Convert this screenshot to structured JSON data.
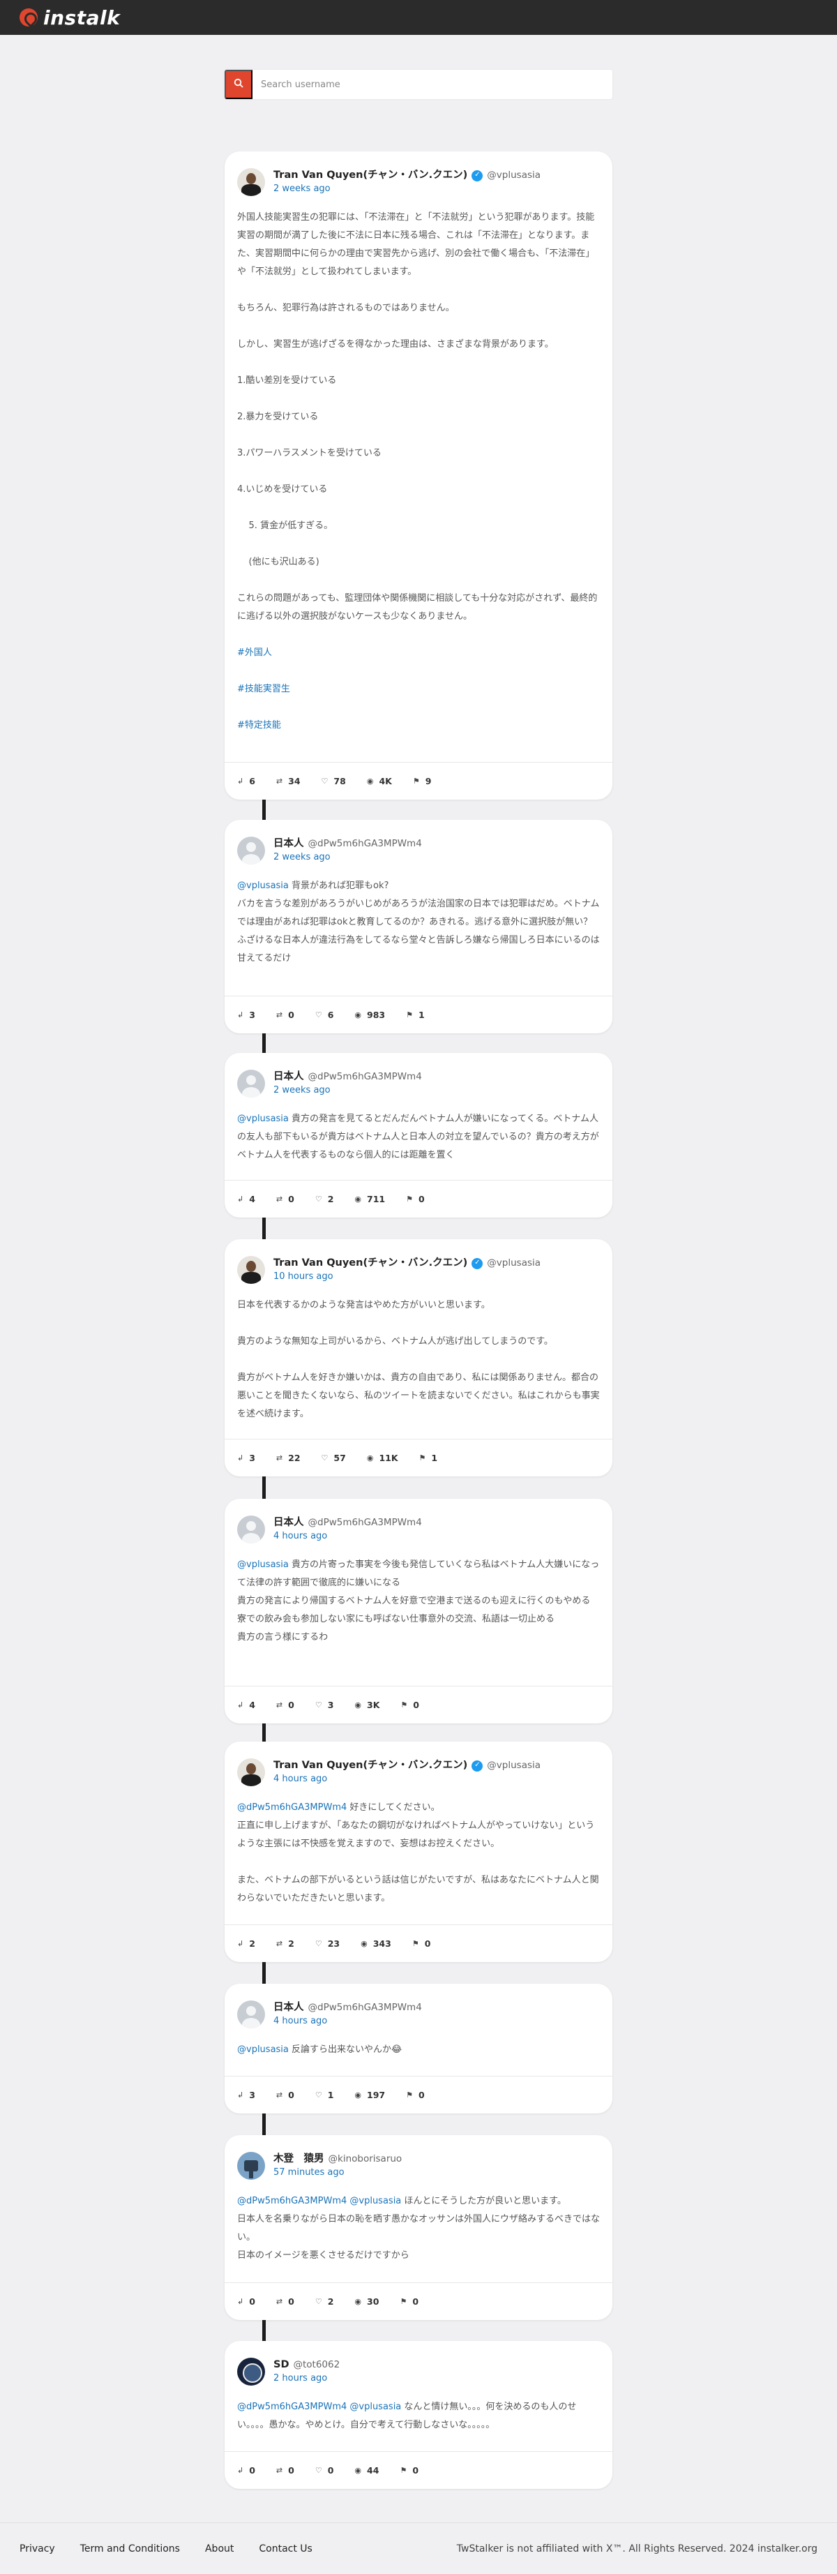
{
  "brand": {
    "logo_text": "instalk"
  },
  "search": {
    "placeholder": "Search username",
    "button_icon": "search-icon"
  },
  "posts": [
    {
      "name": "Tran Van Quyen(チャン・バン.クエン)",
      "verified": true,
      "handle": "@vplusasia",
      "time": "2 weeks ago",
      "lines": [
        "外国人技能実習生の犯罪には、「不法滞在」と「不法就労」という犯罪があります。技能実習の期間が満了した後に不法に日本に残る場合、これは「不法滞在」となります。また、実習期間中に何らかの理由で実習先から逃げ、別の会社で働く場合も、「不法滞在」や「不法就労」として扱われてしまいます。",
        "",
        "もちろん、犯罪行為は許されるものではありません。",
        "",
        "しかし、実習生が逃げざるを得なかった理由は、さまざまな背景があります。",
        "",
        "1.酷い差別を受けている",
        "",
        "2.暴力を受けている",
        "",
        "3.パワーハラスメントを受けている",
        "",
        "4.いじめを受けている",
        "",
        "    5. 賃金が低すぎる。",
        "",
        "    (他にも沢山ある)",
        "",
        "これらの問題があっても、監理団体や関係機関に相談しても十分な対応がされず、最終的に逃げる以外の選択肢がないケースも少なくありません。",
        "",
        "#外国人",
        "",
        "#技能実習生",
        "",
        "#特定技能"
      ],
      "stats": [
        "6",
        "34",
        "78",
        "4K",
        "9"
      ]
    },
    {
      "name": "日本人",
      "verified": false,
      "handle": "@dPw5m6hGA3MPWm4",
      "time": "2 weeks ago",
      "lines": [
        "@vplusasia 背景があれば犯罪もok?",
        "バカを言うな差別があろうがいじめがあろうが法治国家の日本では犯罪はだめ。ベトナムでは理由があれば犯罪はokと教育してるのか？あきれる。逃げる意外に選択肢が無い？",
        "ふざけるな日本人が違法行為をしてるなら堂々と告訴しろ嫌なら帰国しろ日本にいるのは甘えてるだけ"
      ],
      "stats": [
        "3",
        "0",
        "6",
        "983",
        "1"
      ]
    },
    {
      "name": "日本人",
      "verified": false,
      "handle": "@dPw5m6hGA3MPWm4",
      "time": "2 weeks ago",
      "lines": [
        "@vplusasia 貴方の発言を見てるとだんだんベトナム人が嫌いになってくる。ベトナム人の友人も部下もいるが貴方はベトナム人と日本人の対立を望んでいるの？貴方の考え方がベトナム人を代表するものなら個人的には距離を置く"
      ],
      "stats": [
        "4",
        "0",
        "2",
        "711",
        "0"
      ]
    },
    {
      "name": "Tran Van Quyen(チャン・バン.クエン)",
      "verified": true,
      "handle": "@vplusasia",
      "time": "10 hours ago",
      "lines": [
        "日本を代表するかのような発言はやめた方がいいと思います。",
        "",
        "貴方のような無知な上司がいるから、ベトナム人が逃げ出してしまうのです。",
        "",
        "貴方がベトナム人を好きか嫌いかは、貴方の自由であり、私には関係ありません。都合の悪いことを聞きたくないなら、私のツイートを読まないでください。私はこれからも事実を述べ続けます。"
      ],
      "stats": [
        "3",
        "22",
        "57",
        "11K",
        "1"
      ]
    },
    {
      "name": "日本人",
      "verified": false,
      "handle": "@dPw5m6hGA3MPWm4",
      "time": "4 hours ago",
      "lines": [
        "@vplusasia 貴方の片寄った事実を今後も発信していくなら私はベトナム人大嫌いになって法律の許す範囲で徹底的に嫌いになる",
        "貴方の発言により帰国するベトナム人を好意で空港まで送るのも迎えに行くのもやめる",
        "寮での飲み会も参加しない家にも呼ばない仕事意外の交流、私語は一切止める",
        "貴方の言う様にするわ"
      ],
      "stats": [
        "4",
        "0",
        "3",
        "3K",
        "0"
      ]
    },
    {
      "name": "Tran Van Quyen(チャン・バン.クエン)",
      "verified": true,
      "handle": "@vplusasia",
      "time": "4 hours ago",
      "lines": [
        "@dPw5m6hGA3MPWm4 好きにしてください。",
        "正直に申し上げますが、「あなたの鋼切がなければベトナム人がやっていけない」というような主張には不快感を覚えますので、妄想はお控えください。",
        "",
        "また、ベトナムの部下がいるという話は信じがたいですが、私はあなたにベトナム人と関わらないでいただきたいと思います。"
      ],
      "stats": [
        "2",
        "2",
        "23",
        "343",
        "0"
      ]
    },
    {
      "name": "日本人",
      "verified": false,
      "handle": "@dPw5m6hGA3MPWm4",
      "time": "4 hours ago",
      "lines": [
        "@vplusasia 反論すら出来ないやんか😂"
      ],
      "stats": [
        "3",
        "0",
        "1",
        "197",
        "0"
      ]
    },
    {
      "name": "木登　猿男",
      "verified": false,
      "handle": "@kinoborisaruo",
      "time": "57 minutes ago",
      "lines": [
        "@dPw5m6hGA3MPWm4 @vplusasia ほんとにそうした方が良いと思います。",
        "日本人を名乗りながら日本の恥を晒す愚かなオッサンは外国人にウザ絡みするべきではない。",
        "日本のイメージを悪くさせるだけですから"
      ],
      "stats": [
        "0",
        "0",
        "2",
        "30",
        "0"
      ]
    },
    {
      "name": "SD",
      "verified": false,
      "handle": "@tot6062",
      "time": "2 hours ago",
      "lines": [
        "@dPw5m6hGA3MPWm4 @vplusasia なんと情け無い。。。何を決めるのも人のせい。。。。愚かな。やめとけ。自分で考えて行動しなさいな。。。。。"
      ],
      "stats": [
        "0",
        "0",
        "0",
        "44",
        "0"
      ]
    }
  ],
  "stat_icons": [
    "reply-icon",
    "retweet-icon",
    "like-icon",
    "view-icon",
    "bookmark-icon"
  ],
  "footer": {
    "links": [
      "Privacy",
      "Term and Conditions",
      "About",
      "Contact Us"
    ],
    "copyright": "TwStalker is not affiliated with X™. All Rights Reserved. 2024 instalker.org"
  }
}
